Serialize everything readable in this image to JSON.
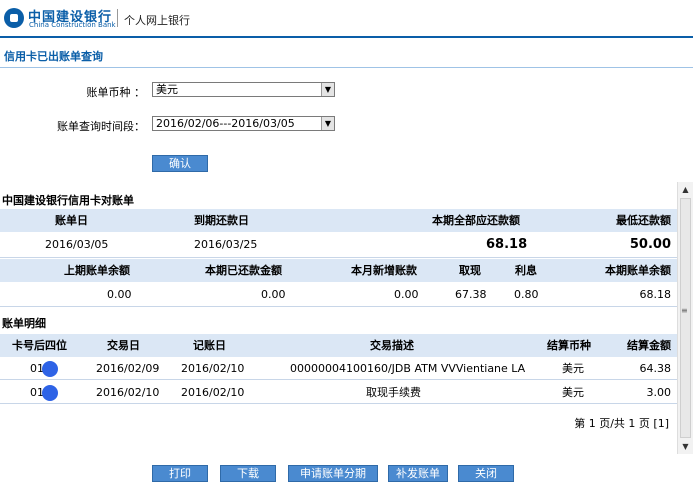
{
  "header": {
    "bank_name_cn": "中国建设银行",
    "bank_name_en": "China Construction Bank",
    "section": "个人网上银行"
  },
  "page_title": "信用卡已出账单查询",
  "form": {
    "currency_label": "账单币种 ：",
    "currency_value": "美元",
    "period_label": "账单查询时间段：",
    "period_value": "2016/02/06---2016/03/05",
    "confirm_label": "确认"
  },
  "statement": {
    "title": "中国建设银行信用卡对账单",
    "summary_headers": [
      "账单日",
      "到期还款日",
      "本期全部应还款额",
      "最低还款额"
    ],
    "summary_values": [
      "2016/03/05",
      "2016/03/25",
      "68.18",
      "50.00"
    ],
    "balance_headers": [
      "上期账单余额",
      "本期已还款金额",
      "本月新增账款",
      "取现",
      "利息",
      "本期账单余额"
    ],
    "balance_values": [
      "0.00",
      "0.00",
      "0.00",
      "67.38",
      "0.80",
      "68.18"
    ]
  },
  "details": {
    "title": "账单明细",
    "headers": [
      "卡号后四位",
      "交易日",
      "记账日",
      "交易描述",
      "结算币种",
      "结算金额"
    ],
    "rows": [
      {
        "card": "01",
        "trans_date": "2016/02/09",
        "post_date": "2016/02/10",
        "desc": "00000004100160/JDB ATM VVVientiane LA",
        "currency": "美元",
        "amount": "64.38"
      },
      {
        "card": "01",
        "trans_date": "2016/02/10",
        "post_date": "2016/02/10",
        "desc": "取现手续费",
        "currency": "美元",
        "amount": "3.00"
      }
    ],
    "pager": "第 1 页/共 1 页 [1]"
  },
  "actions": {
    "print": "打印",
    "download": "下载",
    "installment": "申请账单分期",
    "reissue": "补发账单",
    "close": "关闭"
  },
  "colors": {
    "brand": "#0a5ea8",
    "header_bg": "#dbe7f5",
    "button_bg": "#4a8ad0"
  }
}
